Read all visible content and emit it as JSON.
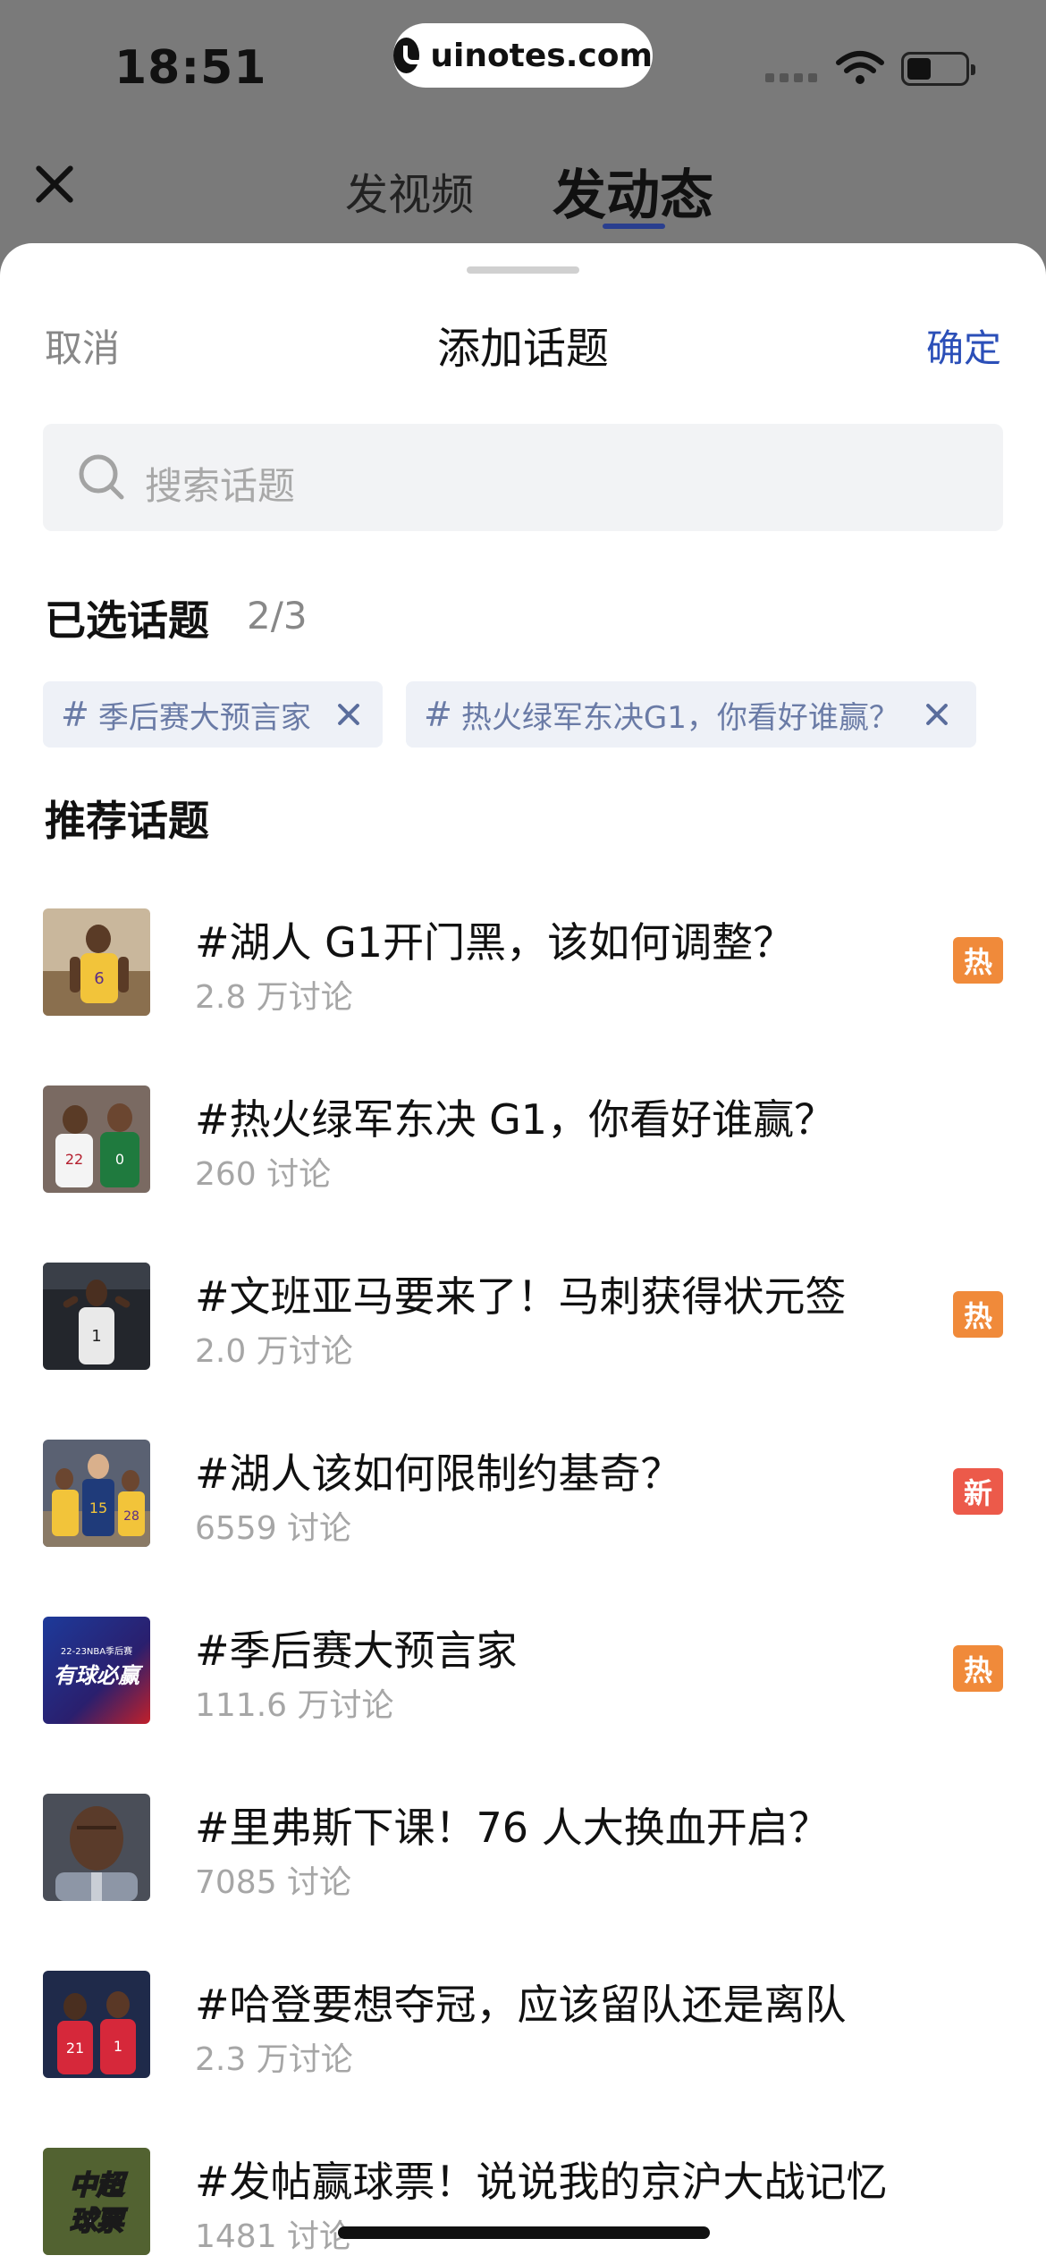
{
  "status_bar": {
    "time": "18:51",
    "url": "uinotes.com"
  },
  "top_tabs": {
    "tab_video": "发视频",
    "tab_post": "发动态"
  },
  "sheet": {
    "cancel": "取消",
    "title": "添加话题",
    "confirm": "确定"
  },
  "search": {
    "placeholder": "搜索话题"
  },
  "selected": {
    "title": "已选话题",
    "count": "2/3",
    "chips": [
      {
        "hash": "#",
        "label": "季后赛大预言家"
      },
      {
        "hash": "#",
        "label": "热火绿军东决G1，你看好谁赢？"
      }
    ]
  },
  "recommended": {
    "title": "推荐话题",
    "items": [
      {
        "title": "#湖人 G1开门黑，该如何调整？",
        "meta": "2.8 万讨论",
        "badge": "热",
        "badge_color": "#f08a3a",
        "thumb": "lebron"
      },
      {
        "title": "#热火绿军东决 G1，你看好谁赢？",
        "meta": "260 讨论",
        "badge": "",
        "badge_color": "",
        "thumb": "heat-celtics"
      },
      {
        "title": "#文班亚马要来了！马刺获得状元签",
        "meta": "2.0 万讨论",
        "badge": "热",
        "badge_color": "#f08a3a",
        "thumb": "spurs"
      },
      {
        "title": "#湖人该如何限制约基奇？",
        "meta": "6559 讨论",
        "badge": "新",
        "badge_color": "#ec5a4a",
        "thumb": "jokic"
      },
      {
        "title": "#季后赛大预言家",
        "meta": "111.6 万讨论",
        "badge": "热",
        "badge_color": "#f08a3a",
        "thumb": "playoff-banner"
      },
      {
        "title": "#里弗斯下课！76 人大换血开启？",
        "meta": "7085 讨论",
        "badge": "",
        "badge_color": "",
        "thumb": "rivers"
      },
      {
        "title": "#哈登要想夺冠，应该留队还是离队",
        "meta": "2.3 万讨论",
        "badge": "",
        "badge_color": "",
        "thumb": "harden"
      },
      {
        "title": "#发帖赢球票！说说我的京沪大战记忆",
        "meta": "1481 讨论",
        "badge": "",
        "badge_color": "",
        "thumb": "csl-banner"
      }
    ]
  }
}
